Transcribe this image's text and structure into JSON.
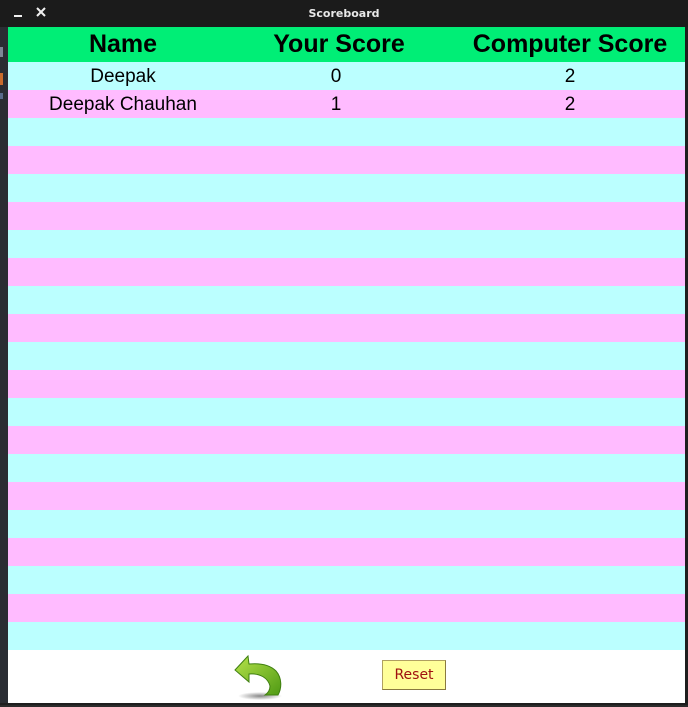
{
  "window": {
    "title": "Scoreboard"
  },
  "table": {
    "headers": [
      "Name",
      "Your Score",
      "Computer Score"
    ],
    "rows": [
      {
        "name": "Deepak",
        "your_score": "0",
        "computer_score": "2"
      },
      {
        "name": "Deepak Chauhan",
        "your_score": "1",
        "computer_score": "2"
      },
      {
        "name": "",
        "your_score": "",
        "computer_score": ""
      },
      {
        "name": "",
        "your_score": "",
        "computer_score": ""
      },
      {
        "name": "",
        "your_score": "",
        "computer_score": ""
      },
      {
        "name": "",
        "your_score": "",
        "computer_score": ""
      },
      {
        "name": "",
        "your_score": "",
        "computer_score": ""
      },
      {
        "name": "",
        "your_score": "",
        "computer_score": ""
      },
      {
        "name": "",
        "your_score": "",
        "computer_score": ""
      },
      {
        "name": "",
        "your_score": "",
        "computer_score": ""
      },
      {
        "name": "",
        "your_score": "",
        "computer_score": ""
      },
      {
        "name": "",
        "your_score": "",
        "computer_score": ""
      },
      {
        "name": "",
        "your_score": "",
        "computer_score": ""
      },
      {
        "name": "",
        "your_score": "",
        "computer_score": ""
      },
      {
        "name": "",
        "your_score": "",
        "computer_score": ""
      },
      {
        "name": "",
        "your_score": "",
        "computer_score": ""
      },
      {
        "name": "",
        "your_score": "",
        "computer_score": ""
      },
      {
        "name": "",
        "your_score": "",
        "computer_score": ""
      },
      {
        "name": "",
        "your_score": "",
        "computer_score": ""
      },
      {
        "name": "",
        "your_score": "",
        "computer_score": ""
      },
      {
        "name": "",
        "your_score": "",
        "computer_score": ""
      }
    ],
    "colors": {
      "header": "#00ee76",
      "row_even": "#bbffff",
      "row_odd": "#ffbbff"
    }
  },
  "footer": {
    "back_icon": "back-arrow-icon",
    "reset_label": "Reset"
  }
}
